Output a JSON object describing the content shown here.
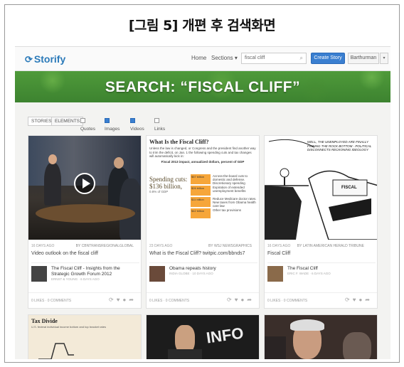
{
  "caption": "[그림 5] 개편 후 검색화면",
  "header": {
    "logo": "Storify",
    "nav_home": "Home",
    "nav_sections": "Sections ▾",
    "search_value": "fiscal cliff",
    "create_label": "Create Story",
    "user_label": "Barthurman"
  },
  "banner": {
    "title": "SEARCH: “FISCAL CLIFF”"
  },
  "filters": {
    "tabs": [
      "STORIES",
      "ELEMENTS"
    ],
    "checks": [
      {
        "label": "Quotes",
        "checked": false
      },
      {
        "label": "Images",
        "checked": true
      },
      {
        "label": "Videos",
        "checked": true
      },
      {
        "label": "Links",
        "checked": false
      }
    ]
  },
  "cards": [
    {
      "meta_time": "16 DAYS AGO",
      "meta_src": "BY CBNTRANSREGIONALGLOBAL",
      "title": "Video outlook on the fiscal cliff",
      "story_title": "The Fiscal Cliff - Insights from the Strategic Growth Forum 2012",
      "story_by": "ERNST & YOUNG · 6 DAYS AGO",
      "likes": "0 LIKES · 0 COMMENTS"
    },
    {
      "meta_time": "23 DAYS AGO",
      "meta_src": "BY WSJ NEWSGRAPHICS",
      "title": "What is the Fiscal Cliff? twitpic.com/bbnds7",
      "story_title": "Obama repeats history",
      "story_by": "INDIA GLOBE · 10 DAYS AGO",
      "likes": "0 LIKES · 0 COMMENTS",
      "info": {
        "heading": "What Is the Fiscal Cliff?",
        "para": "Unless the law is changed, or Congress and the president find another way to trim the deficit, on Jan. 1 the following spending cuts and tax changes will automatically kick in:",
        "sub": "Fiscal 2013 impact, annualized dollars, percent of GDP",
        "left_title": "Spending cuts: $136 billion,",
        "left_sub": "0.8% of GDP",
        "rows": [
          {
            "amt": "$57 billion",
            "desc": "Across-the-board cuts to domestic and defense. Discretionary spending"
          },
          {
            "amt": "$26 billion",
            "desc": "Expiration of extended unemployment benefits"
          },
          {
            "amt": "$11 billion",
            "desc": "Reduce Medicare doctor rates. New taxes from Obama health care law"
          },
          {
            "amt": "$42 billion",
            "desc": "Other tax provisions"
          }
        ]
      }
    },
    {
      "meta_time": "16 DAYS AGO",
      "meta_src": "BY LATIN AMERICAN HERALD TRIBUNE",
      "title": "Fiscal Cliff",
      "story_title": "The Fiscal Cliff",
      "story_by": "ERIC F. WADE · 6 DAYS AGO",
      "likes": "0 LIKES · 0 COMMENTS",
      "cartoon_sign": "FISCAL",
      "cartoon_speech": "WELL, THE UNEMPLOYED ARE FINALLY FINDING THE ROCK BOTTOM - POLITICAL DISCONNECTS RECKONING IDEOLOGY"
    }
  ],
  "bottom": {
    "tax_title": "Tax Divide",
    "tax_sub": "U.S. federal individual income bottom and top bracket rates",
    "info_text": "INFO"
  },
  "colors": {
    "brand_blue": "#2b7ab9",
    "banner_green": "#4f9a3a",
    "create_blue": "#3a7fd0"
  }
}
